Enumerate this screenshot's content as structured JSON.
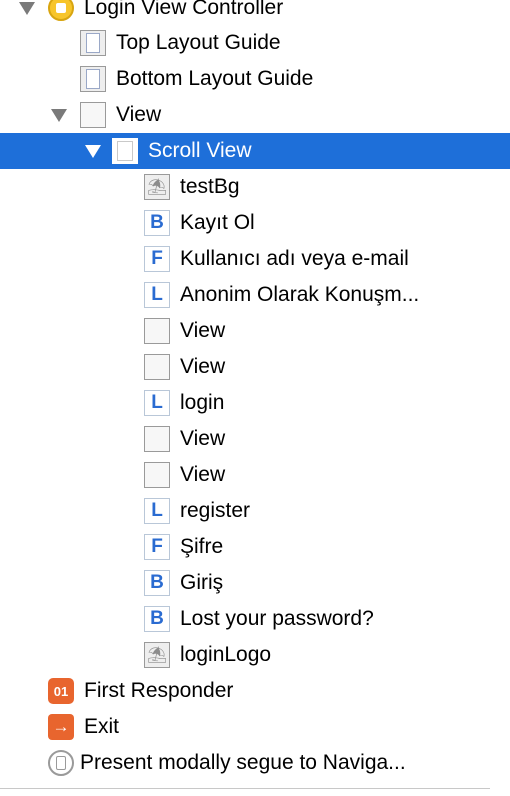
{
  "tree": {
    "login_vc": "Login View Controller",
    "top_layout_guide": "Top Layout Guide",
    "bottom_layout_guide": "Bottom Layout Guide",
    "view": "View",
    "scroll_view": "Scroll View",
    "children": [
      {
        "type": "image",
        "label": "testBg"
      },
      {
        "type": "B",
        "label": "Kayıt Ol"
      },
      {
        "type": "F",
        "label": "Kullanıcı adı veya e-mail"
      },
      {
        "type": "L",
        "label": "Anonim Olarak Konuşm..."
      },
      {
        "type": "view",
        "label": "View"
      },
      {
        "type": "view",
        "label": "View"
      },
      {
        "type": "L",
        "label": "login"
      },
      {
        "type": "view",
        "label": "View"
      },
      {
        "type": "view",
        "label": "View"
      },
      {
        "type": "L",
        "label": "register"
      },
      {
        "type": "F",
        "label": "Şifre"
      },
      {
        "type": "B",
        "label": "Giriş"
      },
      {
        "type": "B",
        "label": "Lost your password?"
      },
      {
        "type": "image",
        "label": "loginLogo"
      }
    ],
    "first_responder": "First Responder",
    "exit": "Exit",
    "segue": "Present modally segue to Naviga..."
  },
  "icon_glyphs": {
    "responder": "01",
    "exit": "→",
    "image": "⛱"
  },
  "colors": {
    "selection": "#1e6fd9",
    "letter_icon": "#2a6bd1",
    "orange_icon": "#e8652e"
  }
}
